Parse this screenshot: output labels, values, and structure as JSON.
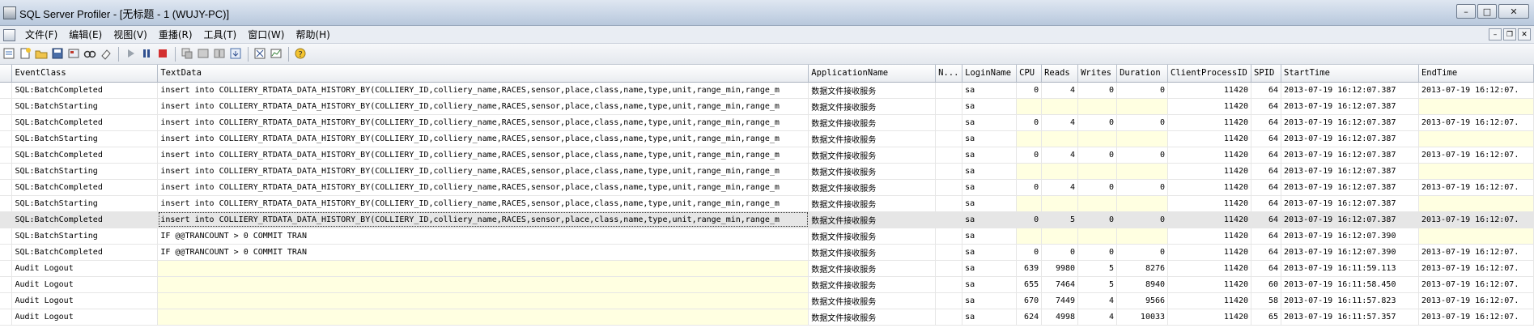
{
  "window": {
    "title": "SQL Server Profiler - [无标题 - 1 (WUJY-PC)]"
  },
  "menu": [
    "文件(F)",
    "编辑(E)",
    "视图(V)",
    "重播(R)",
    "工具(T)",
    "窗口(W)",
    "帮助(H)"
  ],
  "toolbar": [
    "new-trace",
    "new-template",
    "open",
    "save",
    "properties",
    "find",
    "clear",
    "play",
    "pause",
    "stop",
    "template-props",
    "extract",
    "text",
    "autoscroll",
    "summary",
    "data",
    "help"
  ],
  "columns": [
    "EventClass",
    "TextData",
    "ApplicationName",
    "N...",
    "LoginName",
    "CPU",
    "Reads",
    "Writes",
    "Duration",
    "ClientProcessID",
    "SPID",
    "StartTime",
    "EndTime"
  ],
  "rows": [
    [
      "SQL:BatchCompleted",
      "insert into COLLIERY_RTDATA_DATA_HISTORY_BY(COLLIERY_ID,colliery_name,RACES,sensor,place,class,name,type,unit,range_min,range_m",
      "数据文件接收服务",
      "",
      "sa",
      "0",
      "4",
      "0",
      "0",
      "11420",
      "64",
      "2013-07-19 16:12:07.387",
      "2013-07-19 16:12:07."
    ],
    [
      "SQL:BatchStarting",
      "insert into COLLIERY_RTDATA_DATA_HISTORY_BY(COLLIERY_ID,colliery_name,RACES,sensor,place,class,name,type,unit,range_min,range_m",
      "数据文件接收服务",
      "",
      "sa",
      "",
      "",
      "",
      "",
      "11420",
      "64",
      "2013-07-19 16:12:07.387",
      ""
    ],
    [
      "SQL:BatchCompleted",
      "insert into COLLIERY_RTDATA_DATA_HISTORY_BY(COLLIERY_ID,colliery_name,RACES,sensor,place,class,name,type,unit,range_min,range_m",
      "数据文件接收服务",
      "",
      "sa",
      "0",
      "4",
      "0",
      "0",
      "11420",
      "64",
      "2013-07-19 16:12:07.387",
      "2013-07-19 16:12:07."
    ],
    [
      "SQL:BatchStarting",
      "insert into COLLIERY_RTDATA_DATA_HISTORY_BY(COLLIERY_ID,colliery_name,RACES,sensor,place,class,name,type,unit,range_min,range_m",
      "数据文件接收服务",
      "",
      "sa",
      "",
      "",
      "",
      "",
      "11420",
      "64",
      "2013-07-19 16:12:07.387",
      ""
    ],
    [
      "SQL:BatchCompleted",
      "insert into COLLIERY_RTDATA_DATA_HISTORY_BY(COLLIERY_ID,colliery_name,RACES,sensor,place,class,name,type,unit,range_min,range_m",
      "数据文件接收服务",
      "",
      "sa",
      "0",
      "4",
      "0",
      "0",
      "11420",
      "64",
      "2013-07-19 16:12:07.387",
      "2013-07-19 16:12:07."
    ],
    [
      "SQL:BatchStarting",
      "insert into COLLIERY_RTDATA_DATA_HISTORY_BY(COLLIERY_ID,colliery_name,RACES,sensor,place,class,name,type,unit,range_min,range_m",
      "数据文件接收服务",
      "",
      "sa",
      "",
      "",
      "",
      "",
      "11420",
      "64",
      "2013-07-19 16:12:07.387",
      ""
    ],
    [
      "SQL:BatchCompleted",
      "insert into COLLIERY_RTDATA_DATA_HISTORY_BY(COLLIERY_ID,colliery_name,RACES,sensor,place,class,name,type,unit,range_min,range_m",
      "数据文件接收服务",
      "",
      "sa",
      "0",
      "4",
      "0",
      "0",
      "11420",
      "64",
      "2013-07-19 16:12:07.387",
      "2013-07-19 16:12:07."
    ],
    [
      "SQL:BatchStarting",
      "insert into COLLIERY_RTDATA_DATA_HISTORY_BY(COLLIERY_ID,colliery_name,RACES,sensor,place,class,name,type,unit,range_min,range_m",
      "数据文件接收服务",
      "",
      "sa",
      "",
      "",
      "",
      "",
      "11420",
      "64",
      "2013-07-19 16:12:07.387",
      ""
    ],
    [
      "SQL:BatchCompleted",
      "insert into COLLIERY_RTDATA_DATA_HISTORY_BY(COLLIERY_ID,colliery_name,RACES,sensor,place,class,name,type,unit,range_min,range_m",
      "数据文件接收服务",
      "",
      "sa",
      "0",
      "5",
      "0",
      "0",
      "11420",
      "64",
      "2013-07-19 16:12:07.387",
      "2013-07-19 16:12:07."
    ],
    [
      "SQL:BatchStarting",
      "IF @@TRANCOUNT > 0 COMMIT TRAN",
      "数据文件接收服务",
      "",
      "sa",
      "",
      "",
      "",
      "",
      "11420",
      "64",
      "2013-07-19 16:12:07.390",
      ""
    ],
    [
      "SQL:BatchCompleted",
      "IF @@TRANCOUNT > 0 COMMIT TRAN",
      "数据文件接收服务",
      "",
      "sa",
      "0",
      "0",
      "0",
      "0",
      "11420",
      "64",
      "2013-07-19 16:12:07.390",
      "2013-07-19 16:12:07."
    ],
    [
      "Audit Logout",
      "",
      "数据文件接收服务",
      "",
      "sa",
      "639",
      "9980",
      "5",
      "8276",
      "11420",
      "64",
      "2013-07-19 16:11:59.113",
      "2013-07-19 16:12:07."
    ],
    [
      "Audit Logout",
      "",
      "数据文件接收服务",
      "",
      "sa",
      "655",
      "7464",
      "5",
      "8940",
      "11420",
      "60",
      "2013-07-19 16:11:58.450",
      "2013-07-19 16:12:07."
    ],
    [
      "Audit Logout",
      "",
      "数据文件接收服务",
      "",
      "sa",
      "670",
      "7449",
      "4",
      "9566",
      "11420",
      "58",
      "2013-07-19 16:11:57.823",
      "2013-07-19 16:12:07."
    ],
    [
      "Audit Logout",
      "",
      "数据文件接收服务",
      "",
      "sa",
      "624",
      "4998",
      "4",
      "10033",
      "11420",
      "65",
      "2013-07-19 16:11:57.357",
      "2013-07-19 16:12:07."
    ]
  ],
  "selected_row": 8
}
